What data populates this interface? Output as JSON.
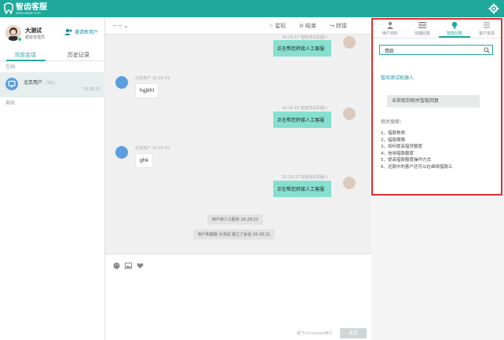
{
  "app": {
    "title": "智齿客服",
    "subtitle": "www.sobot.com"
  },
  "agent": {
    "name": "大测试",
    "role": "超级管理员",
    "invite_label": "邀请新用户"
  },
  "left_tabs": [
    {
      "label": "当前会话"
    },
    {
      "label": "历史记录"
    }
  ],
  "sections": {
    "online": "在线",
    "offline": "离线"
  },
  "customer": {
    "name": "北京用户",
    "tag": "(3句)",
    "time": "16:28:21"
  },
  "chat_toolbar": {
    "select_value": "-- --",
    "star_label": "星标",
    "end_label": "结束",
    "transfer_label": "转接"
  },
  "messages": {
    "agent_meta_1": "16:28:17  智能测试机器人",
    "agent_text_1": "正在帮您转接人工客服",
    "cust_meta_1": "北京用户  16:28:19",
    "cust_text_1": "hgjkhl",
    "agent_meta_2": "16:28:19  智能测试机器人",
    "agent_text_2": "正在帮您转接人工客服",
    "cust_meta_2": "北京用户  16:28:20",
    "cust_text_2": "ghk",
    "agent_meta_3": "16:28:20  智能测试机器人",
    "agent_text_3": "正在帮您转接人工客服",
    "sys_1": "用户转人工服务 16:28:21",
    "sys_2": "用户和客服 大测试 建立了会话 16:28:21"
  },
  "input": {
    "hint": "按下ctrl+enter换行",
    "send_label": "发送"
  },
  "right_tabs": [
    {
      "label": "用户资料"
    },
    {
      "label": "快捷回复"
    },
    {
      "label": "智能回复"
    },
    {
      "label": "客户资源"
    }
  ],
  "smart": {
    "search_value": "借款",
    "bot_name": "智齿测试机器人",
    "no_match": "未获取到相关智能回复",
    "related_title": "相关搜索：",
    "related": [
      "1、借款种类",
      "2、借款期限",
      "3、如何提高借贷额度",
      "4、信用借款额度",
      "5、提高借款额度操作方式",
      "6、还款中的客户还可以在继续借款么"
    ]
  },
  "colors": {
    "brand": "#1fa99d",
    "agent_bubble": "#87e0cf",
    "highlight_border": "#e03030"
  },
  "icons": {
    "logo": "tooth-logo-icon",
    "settings": "gear-icon",
    "invite": "add-user-icon",
    "star": "star-icon",
    "end": "end-session-icon",
    "transfer": "transfer-icon",
    "emoji": "emoji-icon",
    "image": "image-icon",
    "rating": "heart-icon",
    "search": "search-icon"
  }
}
